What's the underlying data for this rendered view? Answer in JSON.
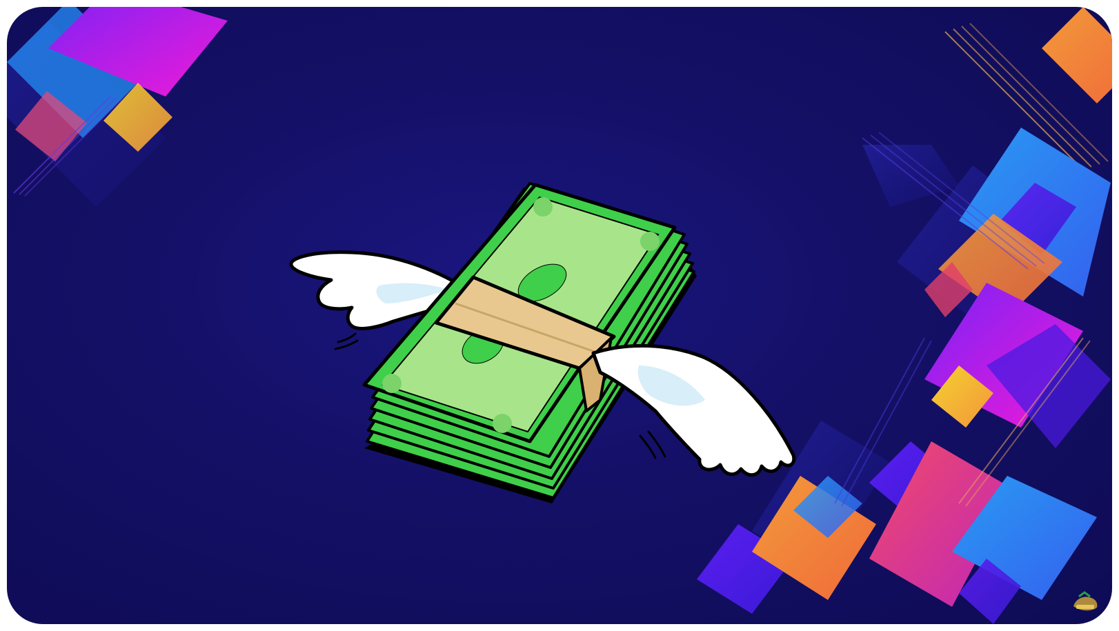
{
  "scene": {
    "subject": "winged-money-stack",
    "background_color": "#141066",
    "palette": {
      "magenta": "#e21ce6",
      "purple": "#6a1cf0",
      "blue": "#2f86f0",
      "orange": "#f28a3a",
      "yellow": "#f2c12e",
      "pink": "#e83a7a",
      "bill_green": "#3fcf4a",
      "bill_light": "#a8e58a",
      "band_tan": "#e8c88e",
      "wing_white": "#ffffff"
    }
  },
  "logo": {
    "name": "brand-badge-icon"
  }
}
